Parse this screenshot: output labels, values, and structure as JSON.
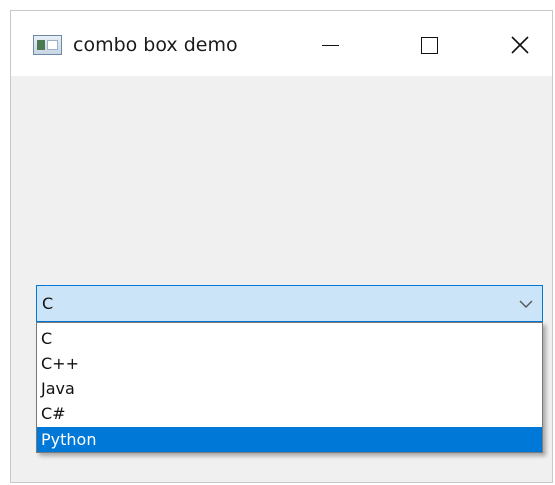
{
  "window": {
    "title": "combo box demo",
    "app_icon": "app-window-icon",
    "controls": {
      "minimize_icon": "minimize-icon",
      "maximize_icon": "maximize-icon",
      "close_icon": "close-icon",
      "close_glyph": "✕"
    }
  },
  "combo": {
    "value": "C",
    "arrow_icon": "chevron-down-icon",
    "dropdown_open": true,
    "options": [
      "C",
      "C++",
      "Java",
      "C#",
      "Python"
    ],
    "highlighted": "Python"
  },
  "colors": {
    "highlight": "#0078d7",
    "combo_focus_bg": "#cce4f7"
  }
}
